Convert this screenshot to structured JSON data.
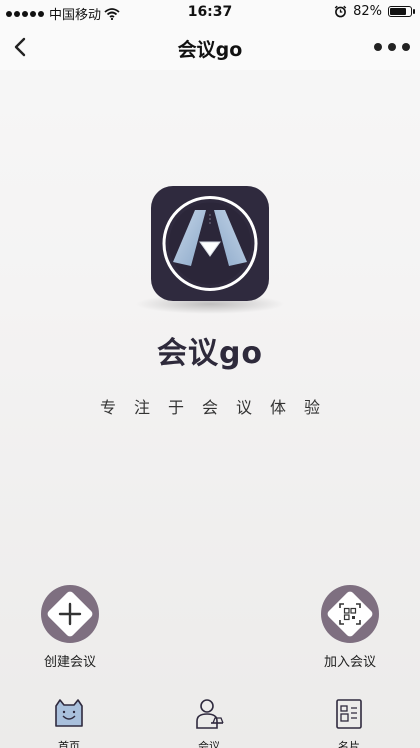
{
  "status_bar": {
    "carrier": "中国移动",
    "time": "16:37",
    "battery_percent": "82%",
    "battery_level": 0.82,
    "icons": [
      "signal-dots-icon",
      "wifi-icon",
      "alarm-icon",
      "battery-icon"
    ]
  },
  "nav_bar": {
    "title": "会议go",
    "back_icon": "back-chevron-icon",
    "more_icon": "more-dots-icon"
  },
  "brand": {
    "app_name": "会议go",
    "slogan": "专注于会议体验",
    "logo_colors": {
      "background": "#2f2a3e",
      "accent": "#a9c3de",
      "ring": "#ffffff"
    }
  },
  "actions": {
    "create": {
      "label": "创建会议",
      "icon": "plus-icon"
    },
    "join": {
      "label": "加入会议",
      "icon": "qr-scan-icon"
    }
  },
  "tab_bar": {
    "items": [
      {
        "label": "首页",
        "icon": "home-cat-icon"
      },
      {
        "label": "会议",
        "icon": "meeting-person-icon"
      },
      {
        "label": "名片",
        "icon": "business-card-icon"
      }
    ]
  },
  "colors": {
    "action_circle": "#7e6f80",
    "tab_home_fill": "#a9c0dc",
    "text_dark": "#2e2a3b"
  }
}
